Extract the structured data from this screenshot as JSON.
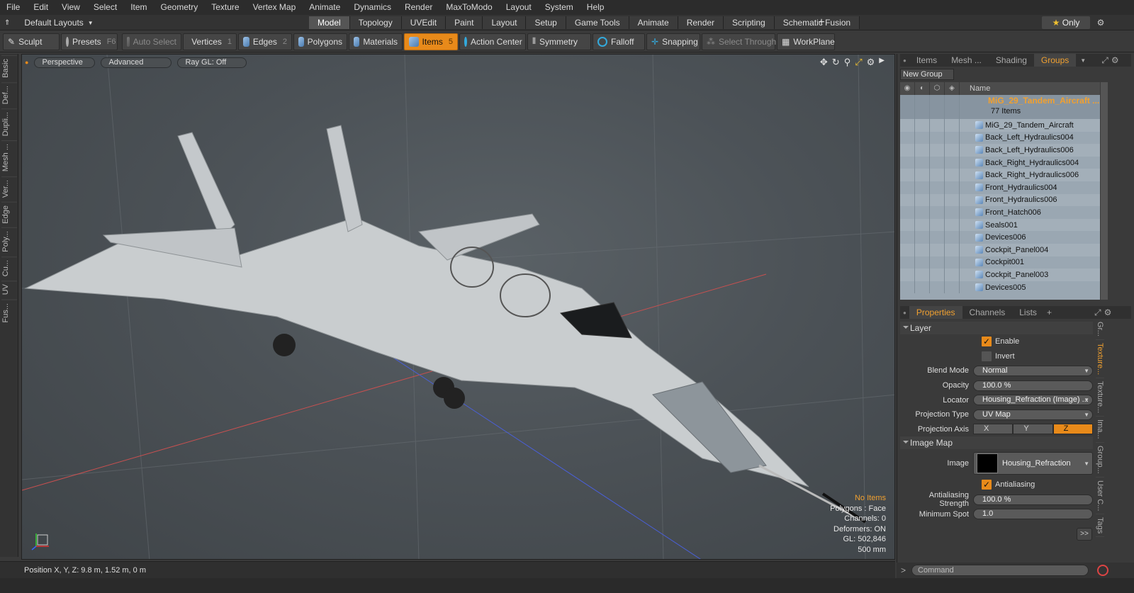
{
  "menubar": {
    "items": [
      "File",
      "Edit",
      "View",
      "Select",
      "Item",
      "Geometry",
      "Texture",
      "Vertex Map",
      "Animate",
      "Dynamics",
      "Render",
      "MaxToModo",
      "Layout",
      "System",
      "Help"
    ]
  },
  "layoutbar": {
    "layout_name": "Default Layouts",
    "tabs": [
      "Model",
      "Topology",
      "UVEdit",
      "Paint",
      "Layout",
      "Setup",
      "Game Tools",
      "Animate",
      "Render",
      "Scripting",
      "Schematic Fusion"
    ],
    "active_tab": "Model",
    "only_label": "Only"
  },
  "toolbar": {
    "sculpt": "Sculpt",
    "presets": "Presets",
    "presets_key": "F6",
    "auto_select": "Auto Select",
    "vertices": "Vertices",
    "vertices_key": "1",
    "edges": "Edges",
    "edges_key": "2",
    "polygons": "Polygons",
    "materials": "Materials",
    "items": "Items",
    "items_key": "5",
    "action_center": "Action Center",
    "symmetry": "Symmetry",
    "falloff": "Falloff",
    "snapping": "Snapping",
    "select_through": "Select Through",
    "workplane": "WorkPlane"
  },
  "left_tabs": [
    "Basic",
    "Def...",
    "Dupli...",
    "Mesh ...",
    "Ver...",
    "Edge",
    "Poly...",
    "Cu...",
    "UV",
    "Fus..."
  ],
  "viewport": {
    "view_mode": "Perspective",
    "shading": "Advanced",
    "raygl": "Ray GL: Off",
    "info": {
      "selection": "No Items",
      "polygons": "Polygons : Face",
      "channels": "Channels: 0",
      "deformers": "Deformers: ON",
      "gl": "GL: 502,846",
      "scale": "500 mm"
    }
  },
  "statusbar": {
    "position": "Position X, Y, Z:   9.8 m, 1.52 m, 0 m"
  },
  "right_panel": {
    "tabs": [
      "Items",
      "Mesh ...",
      "Shading",
      "Groups"
    ],
    "active_tab": "Groups",
    "new_group": "New Group",
    "name_header": "Name",
    "root_group": "MiG_29_Tandem_Aircraft ...",
    "root_count": "77 Items",
    "items": [
      "MiG_29_Tandem_Aircraft",
      "Back_Left_Hydraulics004",
      "Back_Left_Hydraulics006",
      "Back_Right_Hydraulics004",
      "Back_Right_Hydraulics006",
      "Front_Hydraulics004",
      "Front_Hydraulics006",
      "Front_Hatch006",
      "Seals001",
      "Devices006",
      "Cockpit_Panel004",
      "Cockpit001",
      "Cockpit_Panel003",
      "Devices005"
    ]
  },
  "properties": {
    "tabs": [
      "Properties",
      "Channels",
      "Lists"
    ],
    "active_tab": "Properties",
    "layer_section": "Layer",
    "enable_label": "Enable",
    "invert_label": "Invert",
    "blend_mode_label": "Blend Mode",
    "blend_mode": "Normal",
    "opacity_label": "Opacity",
    "opacity": "100.0 %",
    "locator_label": "Locator",
    "locator": "Housing_Refraction (Image) ...",
    "projection_type_label": "Projection Type",
    "projection_type": "UV Map",
    "projection_axis_label": "Projection Axis",
    "axis_x": "X",
    "axis_y": "Y",
    "axis_z": "Z",
    "image_map_section": "Image Map",
    "image_label": "Image",
    "image_name": "Housing_Refraction",
    "antialiasing_label": "Antialiasing",
    "aa_strength_label": "Antialiasing Strength",
    "aa_strength": "100.0 %",
    "min_spot_label": "Minimum Spot",
    "min_spot": "1.0",
    "more": ">>",
    "side_tabs": [
      "Gr...",
      "Texture...",
      "Texture...",
      "Ima...",
      "Group...",
      "User C...",
      "Tags"
    ]
  },
  "command": {
    "placeholder": "Command"
  },
  "colors": {
    "accent": "#e88a1a",
    "selected_text": "#f0a030"
  }
}
